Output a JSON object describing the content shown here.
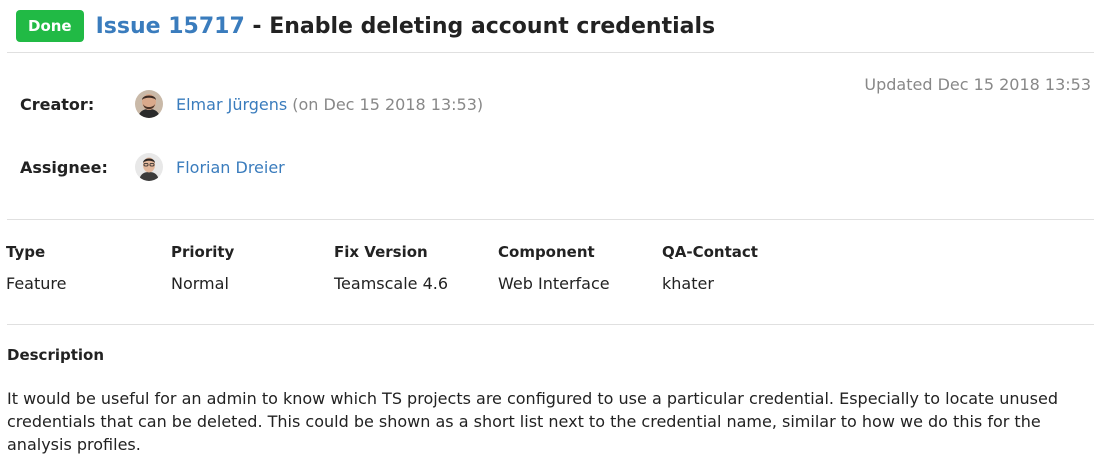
{
  "issue": {
    "status_badge": "Done",
    "issue_link": "Issue 15717",
    "separator": " - ",
    "title": "Enable deleting account credentials",
    "status_color": "#21ba45",
    "link_color": "#3a7cbd"
  },
  "meta": {
    "updated": "Updated Dec 15 2018 13:53",
    "creator": {
      "label": "Creator:",
      "name": "Elmar Jürgens",
      "extra": "(on Dec 15 2018 13:53)",
      "avatar_icon": "avatar-photo"
    },
    "assignee": {
      "label": "Assignee:",
      "name": "Florian Dreier",
      "avatar_icon": "avatar-photo"
    }
  },
  "fields": [
    {
      "label": "Type",
      "value": "Feature"
    },
    {
      "label": "Priority",
      "value": "Normal"
    },
    {
      "label": "Fix Version",
      "value": "Teamscale 4.6"
    },
    {
      "label": "Component",
      "value": "Web Interface"
    },
    {
      "label": "QA-Contact",
      "value": "khater"
    }
  ],
  "description": {
    "label": "Description",
    "text": "It would be useful for an admin to know which TS projects are configured to use a particular credential. Especially to locate unused credentials that can be deleted. This could be shown as a short list next to the credential name, similar to how we do this for the analysis profiles."
  }
}
